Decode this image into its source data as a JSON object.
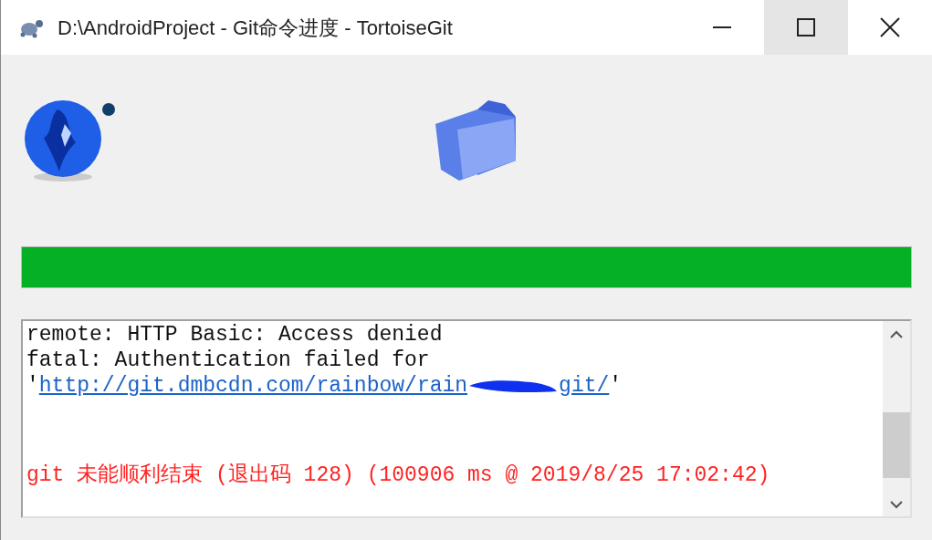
{
  "window": {
    "title": "D:\\AndroidProject - Git命令进度 - TortoiseGit",
    "maximize_hovered": true
  },
  "progress": {
    "level": 1
  },
  "log": {
    "lines": [
      {
        "kind": "text",
        "text": "remote: HTTP Basic: Access denied"
      },
      {
        "kind": "text",
        "text": "fatal: Authentication failed for"
      },
      {
        "kind": "link",
        "quote_open": "'",
        "link_parts": [
          "http://git.dmbcdn.com/rainbow/rain",
          "git/"
        ],
        "redacted": true,
        "quote_close": "'"
      },
      {
        "kind": "error",
        "text": "git 未能顺利结束 (退出码 128) (100906 ms @ 2019/8/25 17:02:42)"
      }
    ]
  }
}
